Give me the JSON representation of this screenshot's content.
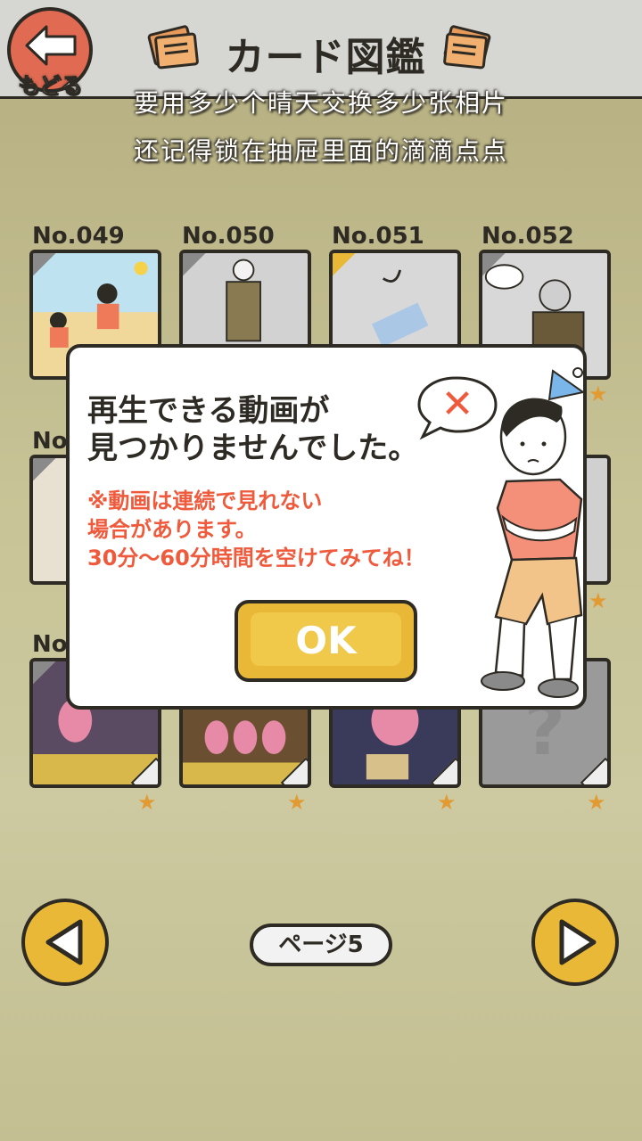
{
  "header": {
    "back_label": "もどる",
    "title": "カード図鑑"
  },
  "overlay_text": {
    "line1": "要用多少个晴天交换多少张相片",
    "line2": "还记得锁在抽屉里面的滴滴点点"
  },
  "cards": {
    "row1": [
      {
        "number": "No.049",
        "star": "★"
      },
      {
        "number": "No.050",
        "star": "★"
      },
      {
        "number": "No.051",
        "star": "★"
      },
      {
        "number": "No.052",
        "star": "★"
      }
    ],
    "row2_label": "No",
    "row3_label": "No",
    "star": "★",
    "mystery": "?"
  },
  "dialog": {
    "message_line1": "再生できる動画が",
    "message_line2": "見つかりませんでした。",
    "note_line1": "※動画は連続で見れない",
    "note_line2": "場合があります。",
    "note_line3": "30分～60分時間を空けてみてね！",
    "ok_label": "OK",
    "error_mark": "✕"
  },
  "footer": {
    "page_label": "ページ5"
  },
  "colors": {
    "accent_yellow": "#e8b836",
    "back_red": "#e06a52",
    "note_red": "#ef5a3c",
    "outline": "#2e2a24"
  }
}
